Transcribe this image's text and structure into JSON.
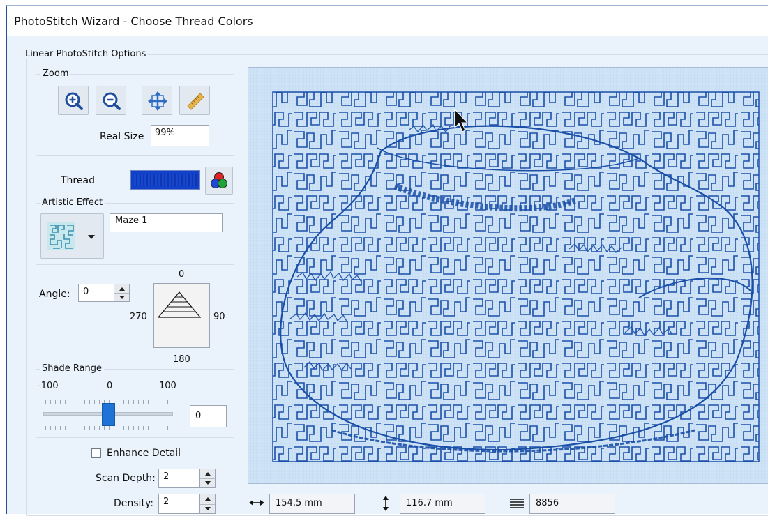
{
  "window": {
    "title": "PhotoStitch Wizard - Choose Thread Colors"
  },
  "options_group": {
    "label": "Linear PhotoStitch Options"
  },
  "zoom": {
    "label": "Zoom",
    "buttons": [
      {
        "name": "zoom-in",
        "icon": "zoom-in-icon"
      },
      {
        "name": "zoom-out",
        "icon": "zoom-out-icon"
      },
      {
        "name": "fit",
        "icon": "fit-to-window-icon"
      },
      {
        "name": "real-size",
        "icon": "ruler-icon"
      }
    ],
    "real_size_label": "Real Size",
    "real_size_value": "99%"
  },
  "thread": {
    "label": "Thread",
    "color": "#1340c8",
    "palette_icon": "color-wheel-icon"
  },
  "artistic_effect": {
    "label": "Artistic Effect",
    "value": "Maze 1",
    "icon": "maze-pattern-icon"
  },
  "angle": {
    "label": "Angle:",
    "value": "0",
    "dial_top": "0",
    "dial_right": "90",
    "dial_bottom": "180",
    "dial_left": "270"
  },
  "shade_range": {
    "label": "Shade Range",
    "min_label": "-100",
    "mid_label": "0",
    "max_label": "100",
    "value": "0",
    "slider_fraction": 0.5
  },
  "enhance_detail": {
    "label": "Enhance Detail",
    "checked": false
  },
  "scan_depth": {
    "label": "Scan Depth:",
    "value": "2"
  },
  "density": {
    "label": "Density:",
    "value": "2"
  },
  "status": {
    "width_icon": "horizontal-arrows-icon",
    "width_value": "154.5 mm",
    "height_icon": "vertical-arrows-icon",
    "height_value": "116.7 mm",
    "stitches_icon": "stitch-count-icon",
    "stitch_count": "8856"
  },
  "preview": {
    "stitch_color": "#1a4fa8",
    "background": "#cfe3f6"
  }
}
